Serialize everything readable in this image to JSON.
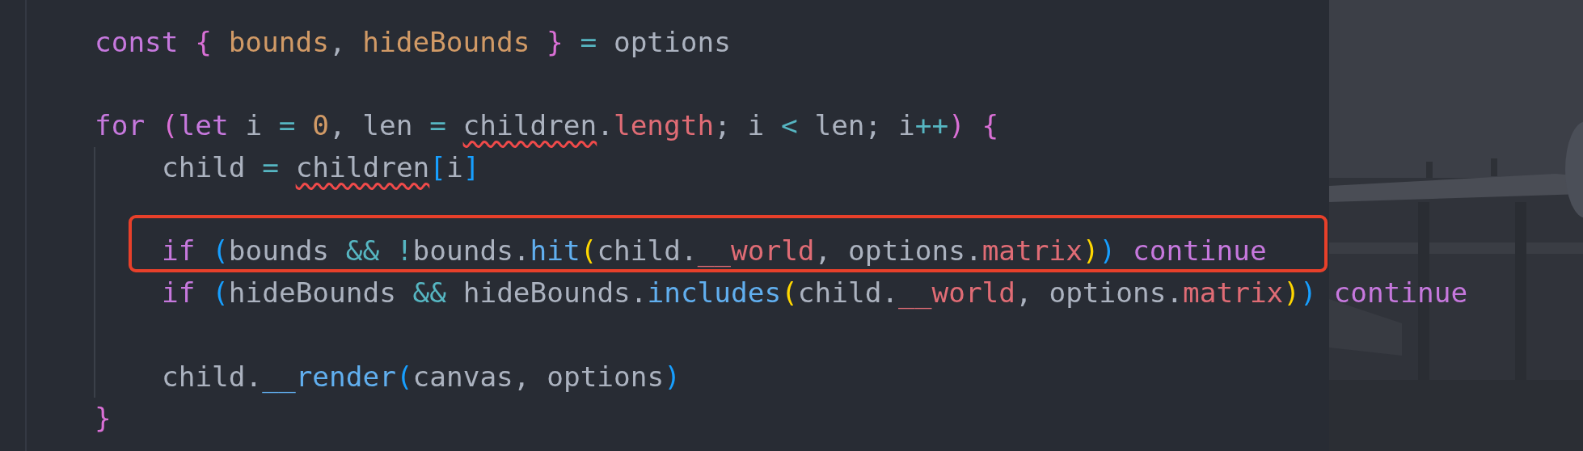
{
  "editor": {
    "lines": [
      {
        "kind": "code",
        "highlighted": false,
        "tokens": [
          {
            "kind": "keyword",
            "text": "const ",
            "error": false
          },
          {
            "kind": "bracket1",
            "text": "{ ",
            "error": false
          },
          {
            "kind": "variable",
            "text": "bounds",
            "error": false
          },
          {
            "kind": "plain",
            "text": ", ",
            "error": false
          },
          {
            "kind": "variable",
            "text": "hideBounds ",
            "error": false
          },
          {
            "kind": "bracket1",
            "text": "} ",
            "error": false
          },
          {
            "kind": "operator",
            "text": "= ",
            "error": false
          },
          {
            "kind": "plain",
            "text": "options",
            "error": false
          }
        ]
      },
      {
        "kind": "blank"
      },
      {
        "kind": "code",
        "highlighted": false,
        "tokens": [
          {
            "kind": "keyword",
            "text": "for ",
            "error": false
          },
          {
            "kind": "bracket1",
            "text": "(",
            "error": false
          },
          {
            "kind": "keyword",
            "text": "let",
            "error": false
          },
          {
            "kind": "plain",
            "text": " i ",
            "error": false
          },
          {
            "kind": "operator",
            "text": "= ",
            "error": false
          },
          {
            "kind": "number",
            "text": "0",
            "error": false
          },
          {
            "kind": "plain",
            "text": ", len ",
            "error": false
          },
          {
            "kind": "operator",
            "text": "= ",
            "error": false
          },
          {
            "kind": "plain",
            "text": "children",
            "error": true
          },
          {
            "kind": "plain",
            "text": ".",
            "error": false
          },
          {
            "kind": "property",
            "text": "length",
            "error": false
          },
          {
            "kind": "plain",
            "text": "; i ",
            "error": false
          },
          {
            "kind": "operator",
            "text": "<",
            "error": false
          },
          {
            "kind": "plain",
            "text": " len; i",
            "error": false
          },
          {
            "kind": "operator",
            "text": "++",
            "error": false
          },
          {
            "kind": "bracket1",
            "text": ") ",
            "error": false
          },
          {
            "kind": "bracket1",
            "text": "{",
            "error": false
          }
        ],
        "children": [
          {
            "kind": "code",
            "highlighted": false,
            "tokens": [
              {
                "kind": "plain",
                "text": "child ",
                "error": false
              },
              {
                "kind": "operator",
                "text": "= ",
                "error": false
              },
              {
                "kind": "plain",
                "text": "children",
                "error": true
              },
              {
                "kind": "bracket2",
                "text": "[",
                "error": false
              },
              {
                "kind": "plain",
                "text": "i",
                "error": false
              },
              {
                "kind": "bracket2",
                "text": "]",
                "error": false
              }
            ]
          },
          {
            "kind": "blank"
          },
          {
            "kind": "code",
            "highlighted": true,
            "tokens": [
              {
                "kind": "keyword",
                "text": "if ",
                "error": false
              },
              {
                "kind": "bracket2",
                "text": "(",
                "error": false
              },
              {
                "kind": "plain",
                "text": "bounds ",
                "error": false
              },
              {
                "kind": "operator",
                "text": "&& !",
                "error": false
              },
              {
                "kind": "plain",
                "text": "bounds.",
                "error": false
              },
              {
                "kind": "function",
                "text": "hit",
                "error": false
              },
              {
                "kind": "bracket3",
                "text": "(",
                "error": false
              },
              {
                "kind": "plain",
                "text": "child.",
                "error": false
              },
              {
                "kind": "property",
                "text": "__world",
                "error": false
              },
              {
                "kind": "plain",
                "text": ", options.",
                "error": false
              },
              {
                "kind": "property",
                "text": "matrix",
                "error": false
              },
              {
                "kind": "bracket3",
                "text": ")",
                "error": false
              },
              {
                "kind": "bracket2",
                "text": ") ",
                "error": false
              },
              {
                "kind": "keyword",
                "text": "continue",
                "error": false
              }
            ]
          },
          {
            "kind": "code",
            "highlighted": false,
            "tokens": [
              {
                "kind": "keyword",
                "text": "if ",
                "error": false
              },
              {
                "kind": "bracket2",
                "text": "(",
                "error": false
              },
              {
                "kind": "plain",
                "text": "hideBounds ",
                "error": false
              },
              {
                "kind": "operator",
                "text": "&&",
                "error": false
              },
              {
                "kind": "plain",
                "text": " hideBounds.",
                "error": false
              },
              {
                "kind": "function",
                "text": "includes",
                "error": false
              },
              {
                "kind": "bracket3",
                "text": "(",
                "error": false
              },
              {
                "kind": "plain",
                "text": "child.",
                "error": false
              },
              {
                "kind": "property",
                "text": "__world",
                "error": false
              },
              {
                "kind": "plain",
                "text": ", options.",
                "error": false
              },
              {
                "kind": "property",
                "text": "matrix",
                "error": false
              },
              {
                "kind": "bracket3",
                "text": ")",
                "error": false
              },
              {
                "kind": "bracket2",
                "text": ") ",
                "error": false
              },
              {
                "kind": "keyword",
                "text": "continue",
                "error": false
              }
            ]
          },
          {
            "kind": "blank"
          },
          {
            "kind": "code",
            "highlighted": false,
            "tokens": [
              {
                "kind": "plain",
                "text": "child.",
                "error": false
              },
              {
                "kind": "function",
                "text": "__render",
                "error": false
              },
              {
                "kind": "bracket2",
                "text": "(",
                "error": false
              },
              {
                "kind": "plain",
                "text": "canvas, options",
                "error": false
              },
              {
                "kind": "bracket2",
                "text": ")",
                "error": false
              }
            ]
          }
        ]
      },
      {
        "kind": "code",
        "highlighted": false,
        "tokens": [
          {
            "kind": "bracket1",
            "text": "}",
            "error": false
          }
        ]
      }
    ]
  }
}
